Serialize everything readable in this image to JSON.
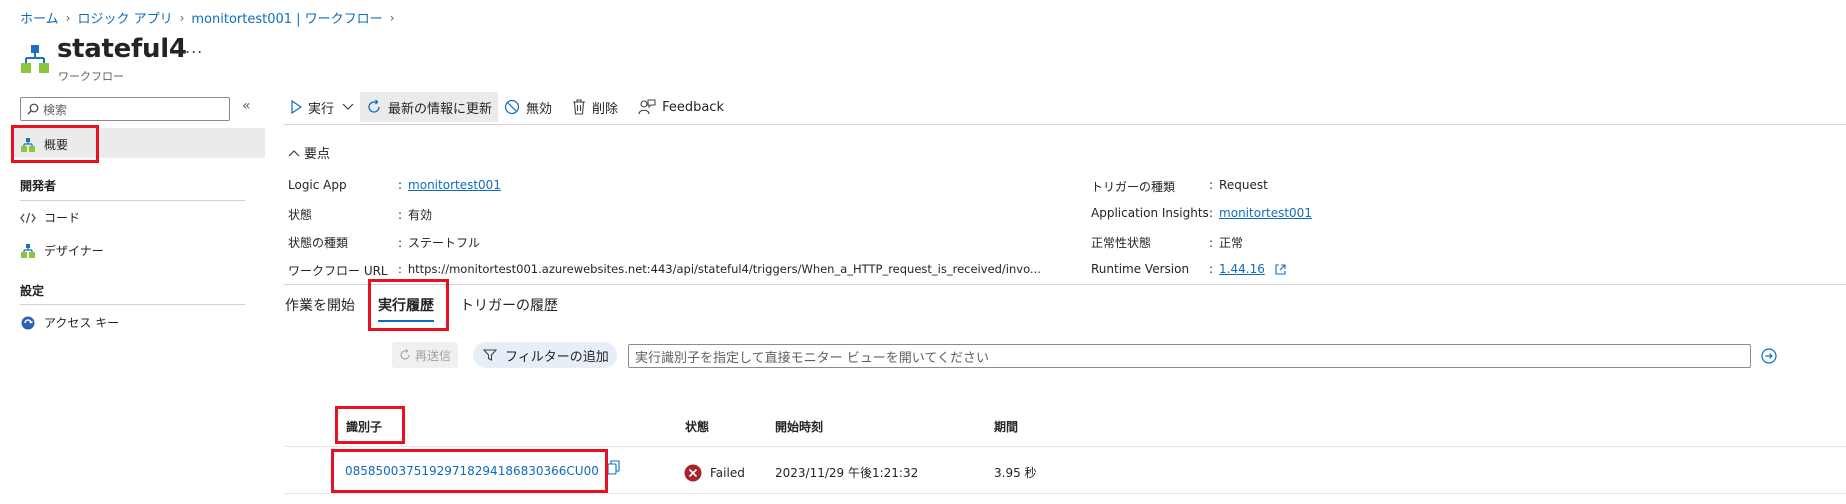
{
  "breadcrumb": [
    "ホーム",
    "ロジック アプリ",
    "monitortest001 | ワークフロー",
    ""
  ],
  "page": {
    "title": "stateful4",
    "subtitle": "ワークフロー",
    "more": "..."
  },
  "sidebar": {
    "search_placeholder": "検索",
    "collapse": "«",
    "overview": "概要",
    "developer_header": "開発者",
    "code": "コード",
    "designer": "デザイナー",
    "settings_header": "設定",
    "access_keys": "アクセス キー"
  },
  "toolbar": {
    "run": "実行",
    "refresh": "最新の情報に更新",
    "disable": "無効",
    "delete": "削除",
    "feedback": "Feedback"
  },
  "essentials": {
    "toggle": "要点",
    "left": [
      {
        "label": "Logic App",
        "value": "monitortest001"
      },
      {
        "label": "状態",
        "value": "有効"
      },
      {
        "label": "状態の種類",
        "value": "ステートフル"
      },
      {
        "label": "ワークフロー URL",
        "value": "https://monitortest001.azurewebsites.net:443/api/stateful4/triggers/When_a_HTTP_request_is_received/invo..."
      }
    ],
    "right": [
      {
        "label": "トリガーの種類",
        "value": "Request"
      },
      {
        "label": "Application Insights",
        "value": "monitortest001"
      },
      {
        "label": "正常性状態",
        "value": "正常"
      },
      {
        "label": "Runtime Version",
        "value": "1.44.16"
      }
    ]
  },
  "tabs": [
    "作業を開始",
    "実行履歴",
    "トリガーの履歴"
  ],
  "filters": {
    "resend": "再送信",
    "add_filter": "フィルターの追加",
    "runid_placeholder": "実行識別子を指定して直接モニター ビューを開いてください"
  },
  "table": {
    "columns": [
      "識別子",
      "状態",
      "開始時刻",
      "期間"
    ],
    "rows": [
      {
        "id": "08585003751929718294186830366CU00",
        "status": "Failed",
        "start": "2023/11/29 午後1:21:32",
        "duration": "3.95 秒"
      }
    ]
  },
  "colors": {
    "accent": "#0f6cbd",
    "highlight": "#e81123",
    "failed": "#a4262c"
  }
}
